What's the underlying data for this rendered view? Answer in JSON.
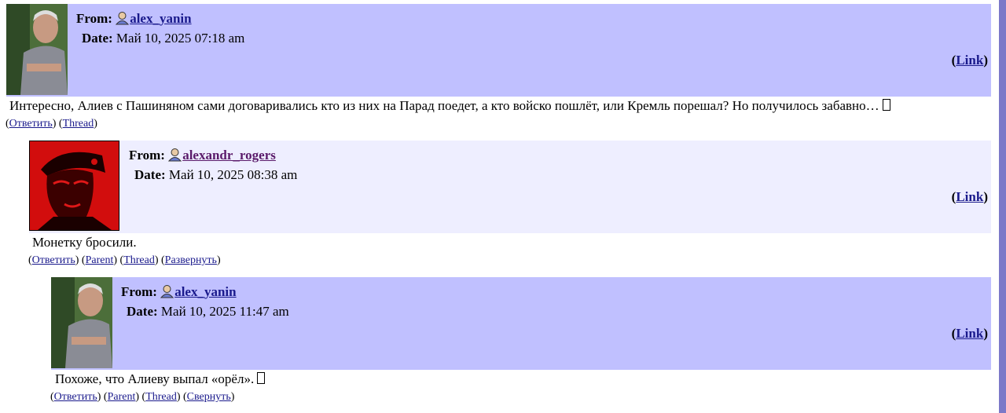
{
  "labels": {
    "from": "From:",
    "date": "Date:"
  },
  "comments": [
    {
      "user": "alex_yanin",
      "date": "Май 10, 2025 07:18 am",
      "link_label": "Link",
      "body": "Интересно, Алиев с Пашиняном сами договаривались кто из них на Парад поедет, а кто войско пошлёт, или Кремль порешал? Но получилось забавно…",
      "actions": [
        "Ответить",
        "Thread"
      ]
    },
    {
      "user": "alexandr_rogers",
      "date": "Май 10, 2025 08:38 am",
      "link_label": "Link",
      "body": "Монетку бросили.",
      "actions": [
        "Ответить",
        "Parent",
        "Thread",
        "Развернуть"
      ]
    },
    {
      "user": "alex_yanin",
      "date": "Май 10, 2025 11:47 am",
      "link_label": "Link",
      "body": "Похоже, что Алиеву выпал «орёл».",
      "actions": [
        "Ответить",
        "Parent",
        "Thread",
        "Свернуть"
      ]
    }
  ],
  "colors": {
    "header_odd": "#c0c0ff",
    "header_even": "#eeeeff",
    "link": "#1a1a8c",
    "scrollbar": "#7b78c8"
  }
}
